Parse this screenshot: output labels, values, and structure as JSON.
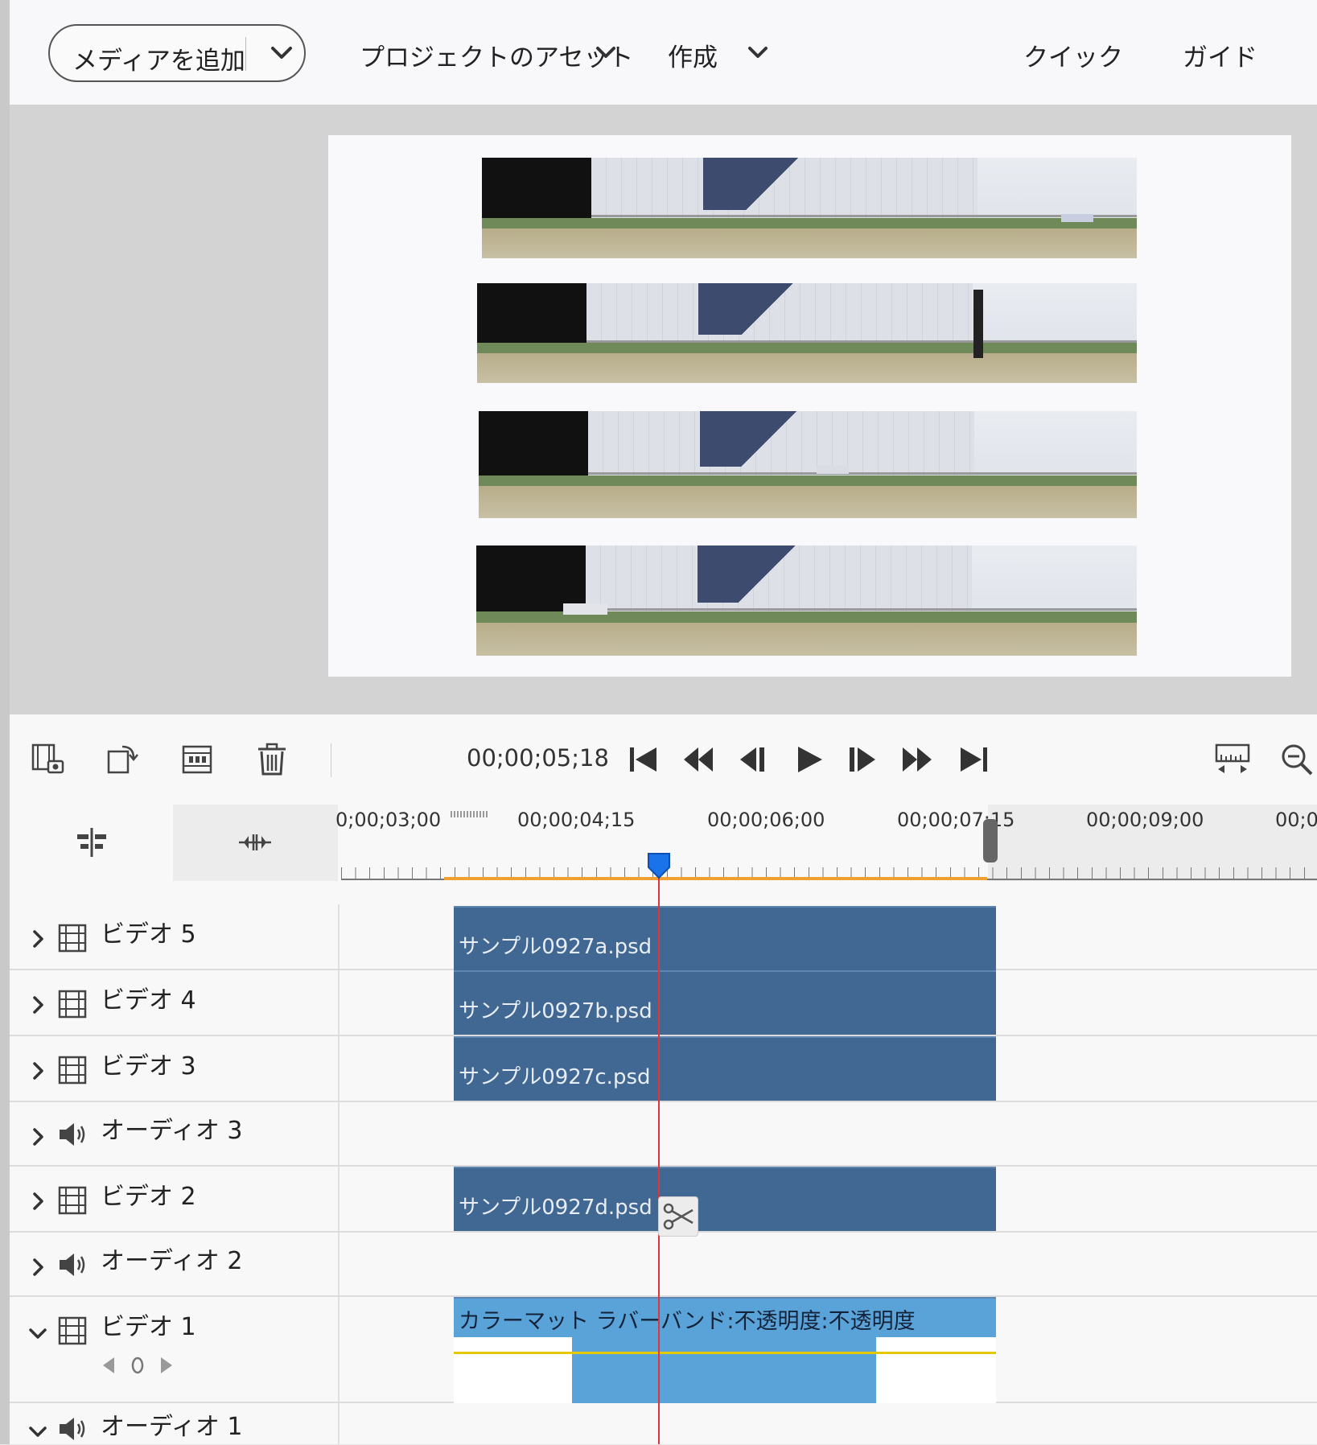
{
  "toolbar": {
    "add_media_label": "メディアを追加",
    "project_assets_label": "プロジェクトのアセット",
    "create_label": "作成",
    "quick_label": "クイック",
    "guide_label": "ガイド"
  },
  "timeline": {
    "timecode": "00;00;05;18",
    "ruler_labels": [
      "0;00;03;00",
      "00;00;04;15",
      "00;00;06;00",
      "00;00;07;15",
      "00;00;09;00",
      "00;0"
    ]
  },
  "tracks": [
    {
      "name": "ビデオ 5",
      "type": "video",
      "expanded": false,
      "clip": "サンプル0927a.psd"
    },
    {
      "name": "ビデオ 4",
      "type": "video",
      "expanded": false,
      "clip": "サンプル0927b.psd"
    },
    {
      "name": "ビデオ 3",
      "type": "video",
      "expanded": false,
      "clip": "サンプル0927c.psd"
    },
    {
      "name": "オーディオ 3",
      "type": "audio",
      "expanded": false,
      "clip": ""
    },
    {
      "name": "ビデオ 2",
      "type": "video",
      "expanded": false,
      "clip": "サンプル0927d.psd"
    },
    {
      "name": "オーディオ 2",
      "type": "audio",
      "expanded": false,
      "clip": ""
    },
    {
      "name": "ビデオ 1",
      "type": "video",
      "expanded": true,
      "clip": "カラーマット ラバーバンド:不透明度:不透明度"
    },
    {
      "name": "オーディオ 1",
      "type": "audio",
      "expanded": true,
      "clip": ""
    }
  ],
  "colors": {
    "clip": "#416893",
    "clip_selected": "#5aa3d8",
    "playhead": "#e0353a",
    "work_area": "#f0a030",
    "playhead_knob": "#1a73e8"
  },
  "icons": {
    "toolbar_left": [
      "add-marker-icon",
      "rotate-icon",
      "film-strip-icon",
      "trash-icon"
    ],
    "transport": [
      "go-to-start-icon",
      "step-back-icon",
      "frame-back-icon",
      "play-icon",
      "frame-forward-icon",
      "step-forward-icon",
      "go-to-end-icon"
    ],
    "toolbar_right": [
      "fit-timeline-icon",
      "zoom-out-icon"
    ]
  }
}
